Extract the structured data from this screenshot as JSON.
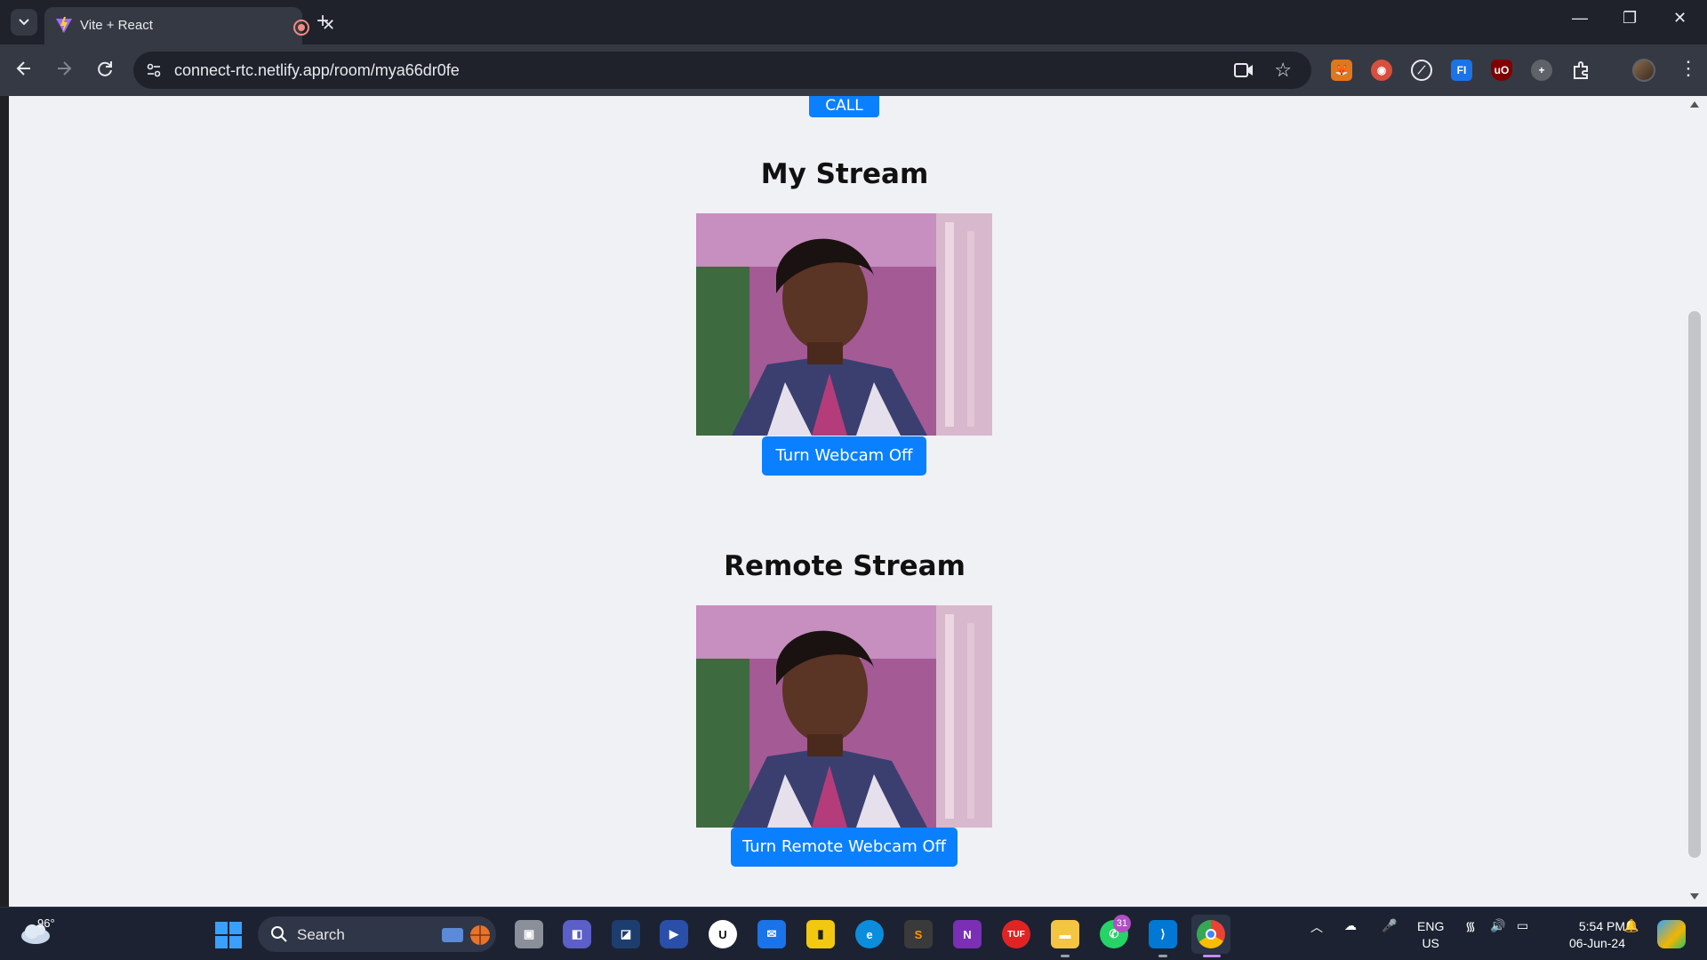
{
  "browser": {
    "tab_title": "Vite + React",
    "tab_close": "✕",
    "new_tab": "+",
    "url": "connect-rtc.netlify.app/room/mya66dr0fe",
    "window_controls": [
      "—",
      "❐",
      "✕"
    ]
  },
  "page": {
    "call_label": "CALL",
    "my_stream_title": "My Stream",
    "my_stream_button": "Turn Webcam Off",
    "remote_stream_title": "Remote Stream",
    "remote_stream_button": "Turn Remote Webcam Off",
    "accent_color": "#0a80ff"
  },
  "taskbar": {
    "weather_temp": "96°",
    "search_label": "Search",
    "whatsapp_badge": "31",
    "lang_line1": "ENG",
    "lang_line2": "US",
    "time": "5:54 PM",
    "date": "06-Jun-24"
  }
}
